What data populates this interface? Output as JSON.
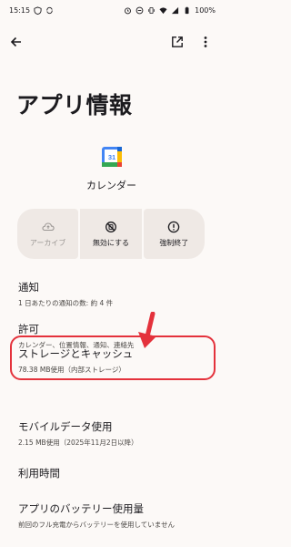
{
  "status_bar": {
    "time": "15:15",
    "battery": "100%"
  },
  "app_bar": {
    "back_icon": "arrow-back-icon",
    "open_icon": "open-in-new-icon",
    "more_icon": "more-vert-icon"
  },
  "page_title": "アプリ情報",
  "app": {
    "name": "カレンダー",
    "icon_text": "31",
    "colors": {
      "blue": "#4285f4",
      "red": "#ea4335",
      "yellow": "#fbbc04",
      "green": "#34a853"
    }
  },
  "actions": [
    {
      "label": "アーカイブ",
      "icon": "cloud-upload-icon",
      "enabled": false
    },
    {
      "label": "無効にする",
      "icon": "disable-icon",
      "enabled": true
    },
    {
      "label": "強制終了",
      "icon": "force-stop-icon",
      "enabled": true
    }
  ],
  "settings": [
    {
      "title": "通知",
      "subtitle": "1 日あたりの通知の数: 約 4 件"
    },
    {
      "title": "許可",
      "subtitle": "カレンダー、位置情報、通知、連絡先"
    },
    {
      "title": "ストレージとキャッシュ",
      "subtitle": "78.38 MB使用（内部ストレージ）"
    },
    {
      "title": "モバイルデータ使用",
      "subtitle": "2.15 MB使用（2025年11月2日以降）"
    },
    {
      "title": "利用時間",
      "subtitle": ""
    },
    {
      "title": "アプリのバッテリー使用量",
      "subtitle": "前回のフル充電からバッテリーを使用していません"
    }
  ],
  "annotation": {
    "color": "#e4323c"
  }
}
